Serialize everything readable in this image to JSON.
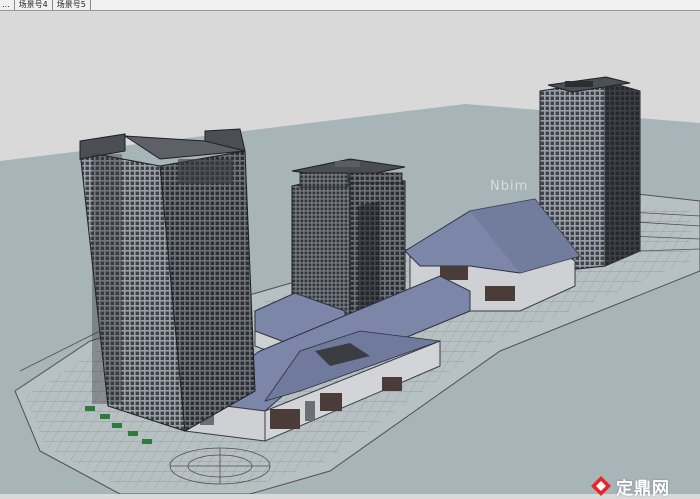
{
  "scene_tabs": [
    "...",
    "场景号4",
    "场景号5"
  ],
  "watermark_top": "Nbim",
  "watermark_logo": "定鼎网",
  "colors": {
    "sky": "#d9d9d9",
    "ground": "#a7b4b8",
    "tower_dark": "#3a3c40",
    "tower_glass": "#6d7178",
    "roof": "#7c86a8",
    "podium_wall": "#cfd0d4",
    "watermark": "#e8262a"
  },
  "icons": [
    "dingding-logo-icon"
  ]
}
